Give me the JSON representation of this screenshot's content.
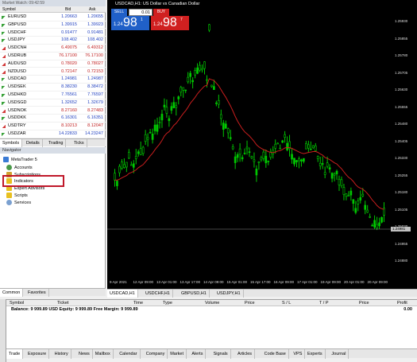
{
  "market_watch": {
    "title": "Market Watch: 09:42:59",
    "columns": [
      "Symbol",
      "Bid",
      "Ask"
    ],
    "rows": [
      {
        "symbol": "EURUSD",
        "bid": "1.20663",
        "ask": "1.20655",
        "dir": "up"
      },
      {
        "symbol": "GBPUSD",
        "bid": "1.39915",
        "ask": "1.39923",
        "dir": "up"
      },
      {
        "symbol": "USDCHF",
        "bid": "0.91477",
        "ask": "0.91481",
        "dir": "up"
      },
      {
        "symbol": "USDJPY",
        "bid": "108.402",
        "ask": "108.402",
        "dir": "up"
      },
      {
        "symbol": "USDCNH",
        "bid": "6.49075",
        "ask": "6.49312",
        "dir": "dn"
      },
      {
        "symbol": "USDRUB",
        "bid": "76.17100",
        "ask": "76.17100",
        "dir": "dn"
      },
      {
        "symbol": "AUDUSD",
        "bid": "0.78020",
        "ask": "0.78027",
        "dir": "dn"
      },
      {
        "symbol": "NZDUSD",
        "bid": "0.72147",
        "ask": "0.72153",
        "dir": "dn"
      },
      {
        "symbol": "USDCAD",
        "bid": "1.24981",
        "ask": "1.24987",
        "dir": "up"
      },
      {
        "symbol": "USDSEK",
        "bid": "8.38230",
        "ask": "8.38472",
        "dir": "up"
      },
      {
        "symbol": "USDHKD",
        "bid": "7.76561",
        "ask": "7.76597",
        "dir": "up"
      },
      {
        "symbol": "USDSGD",
        "bid": "1.32652",
        "ask": "1.32679",
        "dir": "up"
      },
      {
        "symbol": "USDNOK",
        "bid": "8.27160",
        "ask": "8.27483",
        "dir": "dn"
      },
      {
        "symbol": "USDDKK",
        "bid": "6.16301",
        "ask": "6.16351",
        "dir": "up"
      },
      {
        "symbol": "USDTRY",
        "bid": "8.10213",
        "ask": "8.12047",
        "dir": "dn"
      },
      {
        "symbol": "USDZAR",
        "bid": "14.22833",
        "ask": "14.23247",
        "dir": "up"
      }
    ],
    "tabs": [
      "Symbols",
      "Details",
      "Trading",
      "Ticks"
    ]
  },
  "navigator": {
    "title": "Navigator",
    "items": [
      "MetaTrader 5",
      "Accounts",
      "Subscriptions",
      "Indicators",
      "Expert Advisors",
      "Scripts",
      "Services"
    ],
    "tabs": [
      "Common",
      "Favorites"
    ]
  },
  "chart": {
    "title": "USDCAD,H1: US Dollar vs Canadian Dollar",
    "sell_label": "SELL",
    "buy_label": "BUY",
    "lot": "0.01",
    "sell_price": {
      "prefix": "1.24",
      "big": "98",
      "sup": "1"
    },
    "buy_price": {
      "prefix": "1.24",
      "big": "98",
      "sup": "7"
    },
    "price_labels": [
      "1.25930",
      "1.25855",
      "1.25780",
      "1.25705",
      "1.25630",
      "1.25555",
      "1.25480",
      "1.25405",
      "1.25330",
      "1.25255",
      "1.25180",
      "1.25105",
      "1.25030",
      "1.24955",
      "1.24880"
    ],
    "current_price": "1.24981",
    "time_labels": [
      "9 Apr 2021",
      "12 Apr 09:00",
      "13 Apr 01:00",
      "13 Apr 17:00",
      "14 Apr 09:00",
      "15 Apr 01:00",
      "15 Apr 17:00",
      "16 Apr 09:00",
      "17 Apr 01:00",
      "19 Apr 09:00",
      "20 Apr 01:00",
      "20 Apr 09:00"
    ],
    "tabs": [
      "USDCAD,H1",
      "USDCHF,H1",
      "GBPUSD,H1",
      "USDJPY,H1"
    ],
    "colors": {
      "bull": "#00c800",
      "bear": "#00c800",
      "ma": "#c81e1e"
    }
  },
  "toolbox": {
    "columns": [
      "Symbol",
      "Ticket",
      "Time",
      "Type",
      "Volume",
      "Price",
      "S / L",
      "T / P",
      "Price",
      "Profit"
    ],
    "balance_line": "Balance: 9 999.89 USD  Equity: 9 999.89  Free Margin: 9 999.89",
    "balance_value": "0.00",
    "tabs": [
      "Trade",
      "Exposure",
      "History",
      "News",
      "Mailbox",
      "Calendar",
      "Company",
      "Market",
      "Alerts",
      "Signals",
      "Articles",
      "Code Base",
      "VPS",
      "Experts",
      "Journal"
    ]
  }
}
